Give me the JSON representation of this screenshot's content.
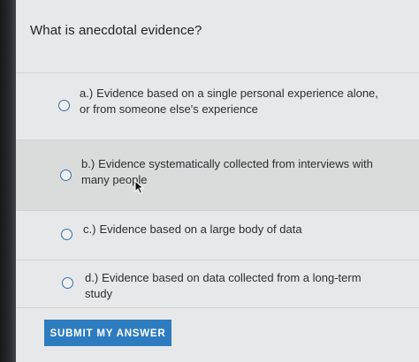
{
  "question": {
    "text": "What is anecdotal evidence?"
  },
  "options": [
    {
      "letter": "a.)",
      "text": "Evidence based on a single personal experience alone, or from someone else's experience",
      "selected": false
    },
    {
      "letter": "b.)",
      "text": "Evidence systematically collected from interviews with many people",
      "selected": false
    },
    {
      "letter": "c.)",
      "text": "Evidence based on a large body of data",
      "selected": false
    },
    {
      "letter": "d.)",
      "text": "Evidence based on data collected from a long-term study",
      "selected": false
    }
  ],
  "submit": {
    "label": "SUBMIT MY ANSWER"
  },
  "colors": {
    "accent": "#2e7cc0",
    "radio_border": "#3b6ea5",
    "card_bg": "#e7e8e9"
  },
  "icons": {
    "cursor": "mouse-pointer-icon",
    "radio": "radio-circle-icon"
  }
}
